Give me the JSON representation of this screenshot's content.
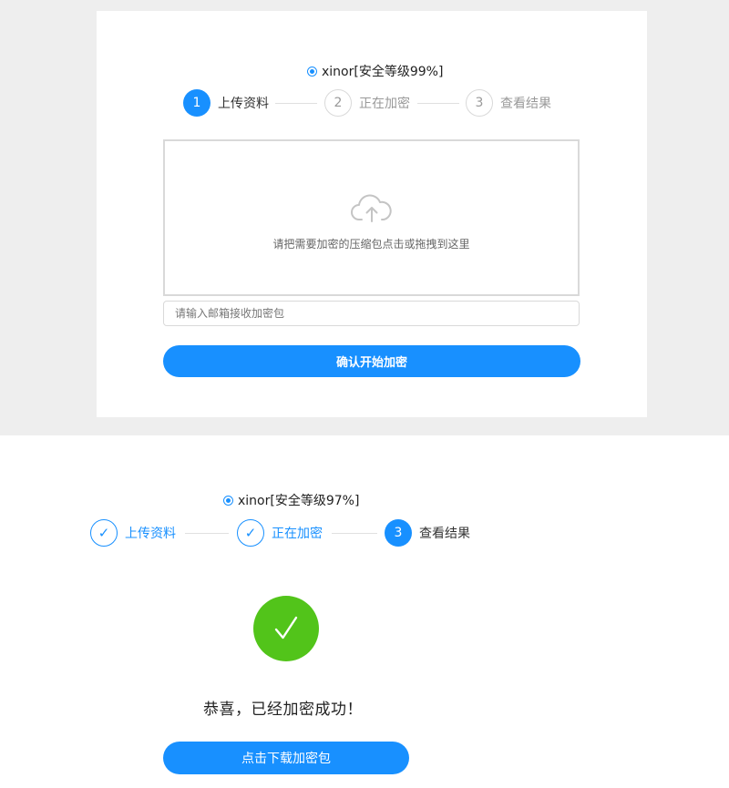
{
  "panel1": {
    "method": {
      "label": "xinor[安全等级99%]"
    },
    "steps": [
      {
        "number": "1",
        "label": "上传资料",
        "state": "active"
      },
      {
        "number": "2",
        "label": "正在加密",
        "state": "pending"
      },
      {
        "number": "3",
        "label": "查看结果",
        "state": "pending"
      }
    ],
    "upload": {
      "icon": "cloud-upload-icon",
      "hint": "请把需要加密的压缩包点击或拖拽到这里"
    },
    "email": {
      "placeholder": "请输入邮箱接收加密包",
      "value": ""
    },
    "submit_label": "确认开始加密"
  },
  "panel2": {
    "method": {
      "label": "xinor[安全等级97%]"
    },
    "steps": [
      {
        "number": "✓",
        "label": "上传资料",
        "state": "done"
      },
      {
        "number": "✓",
        "label": "正在加密",
        "state": "done"
      },
      {
        "number": "3",
        "label": "查看结果",
        "state": "active"
      }
    ],
    "success_icon": "checkmark-icon",
    "message": "恭喜，已经加密成功！",
    "download_label": "点击下载加密包"
  },
  "colors": {
    "primary": "#1890ff",
    "success": "#52c41a",
    "border": "#d9d9d9",
    "background": "#eeeeee"
  }
}
